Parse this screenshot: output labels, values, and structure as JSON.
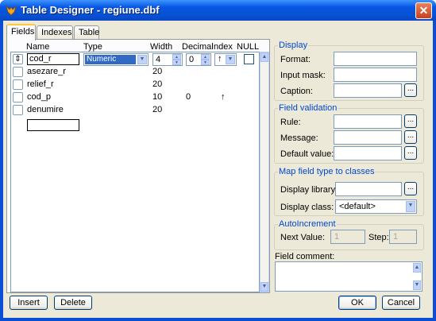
{
  "window": {
    "title": "Table Designer - regiune.dbf",
    "close_glyph": "✕",
    "icon": "fox-icon"
  },
  "tabs": [
    {
      "label": "Fields"
    },
    {
      "label": "Indexes"
    },
    {
      "label": "Table"
    }
  ],
  "columns": {
    "name": "Name",
    "type": "Type",
    "width": "Width",
    "decimal": "Decimal",
    "index": "Index",
    "null": "NULL"
  },
  "rows": [
    {
      "name": "cod_r",
      "type": "Numeric",
      "width": "4",
      "decimal": "0",
      "index": "↑"
    },
    {
      "name": "asezare_r",
      "type": "",
      "width": "20",
      "decimal": "",
      "index": ""
    },
    {
      "name": "relief_r",
      "type": "",
      "width": "20",
      "decimal": "",
      "index": ""
    },
    {
      "name": "cod_p",
      "type": "",
      "width": "10",
      "decimal": "0",
      "index": "↑"
    },
    {
      "name": "denumire",
      "type": "",
      "width": "20",
      "decimal": "",
      "index": ""
    }
  ],
  "display": {
    "title": "Display",
    "format": "Format:",
    "input_mask": "Input mask:",
    "caption": "Caption:"
  },
  "validation": {
    "title": "Field validation",
    "rule": "Rule:",
    "message": "Message:",
    "default_value": "Default value:"
  },
  "map": {
    "title": "Map field type to classes",
    "library": "Display library:",
    "class": "Display class:",
    "class_value": "<default>"
  },
  "autoinc": {
    "title": "AutoIncrement",
    "next": "Next Value:",
    "next_value": "1",
    "step": "Step:",
    "step_value": "1"
  },
  "comment": {
    "label": "Field comment:"
  },
  "buttons": {
    "insert": "Insert",
    "delete": "Delete",
    "ok": "OK",
    "cancel": "Cancel",
    "ellipsis": "..."
  },
  "colors": {
    "titlebar": "#0854e3",
    "accent_tab": "#ffc83c",
    "group_title": "#0046d5",
    "selection": "#316ac5"
  }
}
